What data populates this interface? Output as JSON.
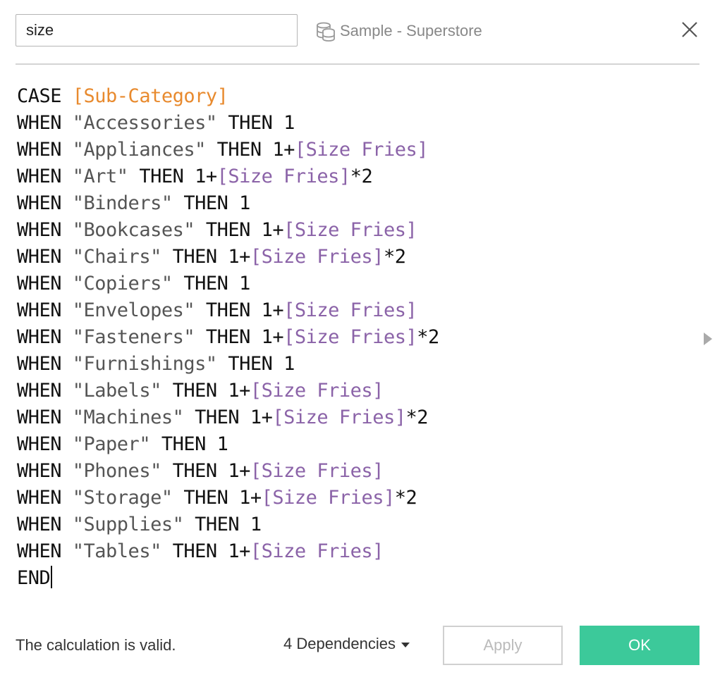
{
  "header": {
    "calc_name": "size",
    "datasource_label": "Sample - Superstore"
  },
  "editor": {
    "lines": [
      [
        {
          "t": "CASE ",
          "c": "kw"
        },
        {
          "t": "[Sub-Category]",
          "c": "field-orange"
        }
      ],
      [
        {
          "t": "WHEN ",
          "c": "kw"
        },
        {
          "t": "\"Accessories\"",
          "c": "str"
        },
        {
          "t": " THEN 1",
          "c": "kw"
        }
      ],
      [
        {
          "t": "WHEN ",
          "c": "kw"
        },
        {
          "t": "\"Appliances\"",
          "c": "str"
        },
        {
          "t": " THEN 1+",
          "c": "kw"
        },
        {
          "t": "[Size Fries]",
          "c": "field-purple"
        }
      ],
      [
        {
          "t": "WHEN ",
          "c": "kw"
        },
        {
          "t": "\"Art\"",
          "c": "str"
        },
        {
          "t": " THEN 1+",
          "c": "kw"
        },
        {
          "t": "[Size Fries]",
          "c": "field-purple"
        },
        {
          "t": "*2",
          "c": "kw"
        }
      ],
      [
        {
          "t": "WHEN ",
          "c": "kw"
        },
        {
          "t": "\"Binders\"",
          "c": "str"
        },
        {
          "t": " THEN 1",
          "c": "kw"
        }
      ],
      [
        {
          "t": "WHEN ",
          "c": "kw"
        },
        {
          "t": "\"Bookcases\"",
          "c": "str"
        },
        {
          "t": " THEN 1+",
          "c": "kw"
        },
        {
          "t": "[Size Fries]",
          "c": "field-purple"
        }
      ],
      [
        {
          "t": "WHEN ",
          "c": "kw"
        },
        {
          "t": "\"Chairs\"",
          "c": "str"
        },
        {
          "t": " THEN 1+",
          "c": "kw"
        },
        {
          "t": "[Size Fries]",
          "c": "field-purple"
        },
        {
          "t": "*2",
          "c": "kw"
        }
      ],
      [
        {
          "t": "WHEN ",
          "c": "kw"
        },
        {
          "t": "\"Copiers\"",
          "c": "str"
        },
        {
          "t": " THEN 1",
          "c": "kw"
        }
      ],
      [
        {
          "t": "WHEN ",
          "c": "kw"
        },
        {
          "t": "\"Envelopes\"",
          "c": "str"
        },
        {
          "t": " THEN 1+",
          "c": "kw"
        },
        {
          "t": "[Size Fries]",
          "c": "field-purple"
        }
      ],
      [
        {
          "t": "WHEN ",
          "c": "kw"
        },
        {
          "t": "\"Fasteners\"",
          "c": "str"
        },
        {
          "t": " THEN 1+",
          "c": "kw"
        },
        {
          "t": "[Size Fries]",
          "c": "field-purple"
        },
        {
          "t": "*2",
          "c": "kw"
        }
      ],
      [
        {
          "t": "WHEN ",
          "c": "kw"
        },
        {
          "t": "\"Furnishings\"",
          "c": "str"
        },
        {
          "t": " THEN 1",
          "c": "kw"
        }
      ],
      [
        {
          "t": "WHEN ",
          "c": "kw"
        },
        {
          "t": "\"Labels\"",
          "c": "str"
        },
        {
          "t": " THEN 1+",
          "c": "kw"
        },
        {
          "t": "[Size Fries]",
          "c": "field-purple"
        }
      ],
      [
        {
          "t": "WHEN ",
          "c": "kw"
        },
        {
          "t": "\"Machines\"",
          "c": "str"
        },
        {
          "t": " THEN 1+",
          "c": "kw"
        },
        {
          "t": "[Size Fries]",
          "c": "field-purple"
        },
        {
          "t": "*2",
          "c": "kw"
        }
      ],
      [
        {
          "t": "WHEN ",
          "c": "kw"
        },
        {
          "t": "\"Paper\"",
          "c": "str"
        },
        {
          "t": " THEN 1",
          "c": "kw"
        }
      ],
      [
        {
          "t": "WHEN ",
          "c": "kw"
        },
        {
          "t": "\"Phones\"",
          "c": "str"
        },
        {
          "t": " THEN 1+",
          "c": "kw"
        },
        {
          "t": "[Size Fries]",
          "c": "field-purple"
        }
      ],
      [
        {
          "t": "WHEN ",
          "c": "kw"
        },
        {
          "t": "\"Storage\"",
          "c": "str"
        },
        {
          "t": " THEN 1+",
          "c": "kw"
        },
        {
          "t": "[Size Fries]",
          "c": "field-purple"
        },
        {
          "t": "*2",
          "c": "kw"
        }
      ],
      [
        {
          "t": "WHEN ",
          "c": "kw"
        },
        {
          "t": "\"Supplies\"",
          "c": "str"
        },
        {
          "t": " THEN 1",
          "c": "kw"
        }
      ],
      [
        {
          "t": "WHEN ",
          "c": "kw"
        },
        {
          "t": "\"Tables\"",
          "c": "str"
        },
        {
          "t": " THEN 1+",
          "c": "kw"
        },
        {
          "t": "[Size Fries]",
          "c": "field-purple"
        }
      ],
      [
        {
          "t": "END",
          "c": "kw"
        }
      ]
    ]
  },
  "footer": {
    "status_text": "The calculation is valid.",
    "dependencies_label": "4 Dependencies",
    "apply_label": "Apply",
    "ok_label": "OK"
  },
  "icons": {
    "datasource": "database-icon",
    "close": "close-icon",
    "dependencies": "caret-down-icon",
    "side_panel": "chevron-right-icon"
  },
  "colors": {
    "field_dimension": "#e88a2e",
    "field_parameter": "#8b63a8",
    "string_literal": "#555555",
    "ok_button": "#3cc99a",
    "apply_disabled_text": "#bbbbbb"
  }
}
